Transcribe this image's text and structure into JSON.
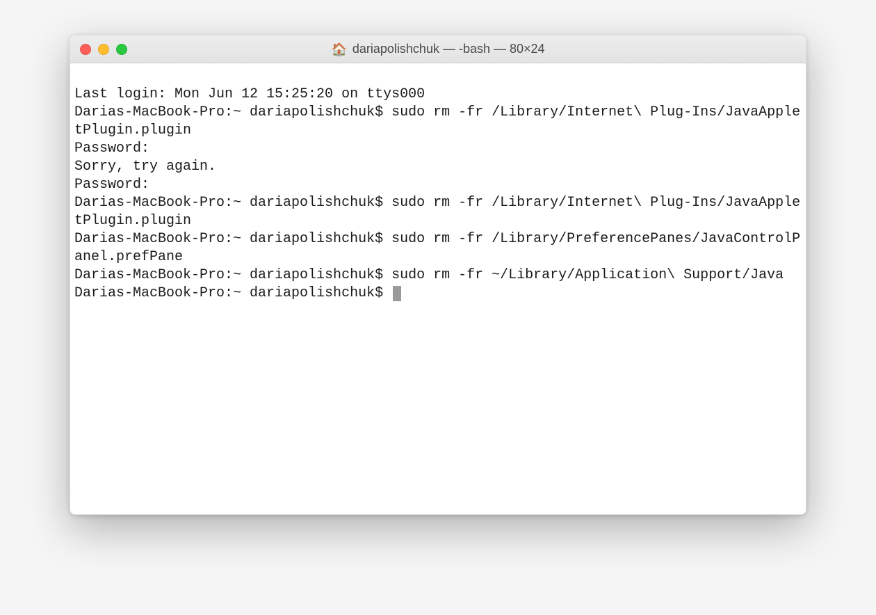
{
  "window": {
    "title": "dariapolishchuk — -bash — 80×24"
  },
  "terminal": {
    "lines": [
      "Last login: Mon Jun 12 15:25:20 on ttys000",
      "Darias-MacBook-Pro:~ dariapolishchuk$ sudo rm -fr /Library/Internet\\ Plug-Ins/JavaAppletPlugin.plugin",
      "Password:",
      "Sorry, try again.",
      "Password:",
      "Darias-MacBook-Pro:~ dariapolishchuk$ sudo rm -fr /Library/Internet\\ Plug-Ins/JavaAppletPlugin.plugin",
      "Darias-MacBook-Pro:~ dariapolishchuk$ sudo rm -fr /Library/PreferencePanes/JavaControlPanel.prefPane",
      "Darias-MacBook-Pro:~ dariapolishchuk$ sudo rm -fr ~/Library/Application\\ Support/Java"
    ],
    "prompt": "Darias-MacBook-Pro:~ dariapolishchuk$ "
  }
}
